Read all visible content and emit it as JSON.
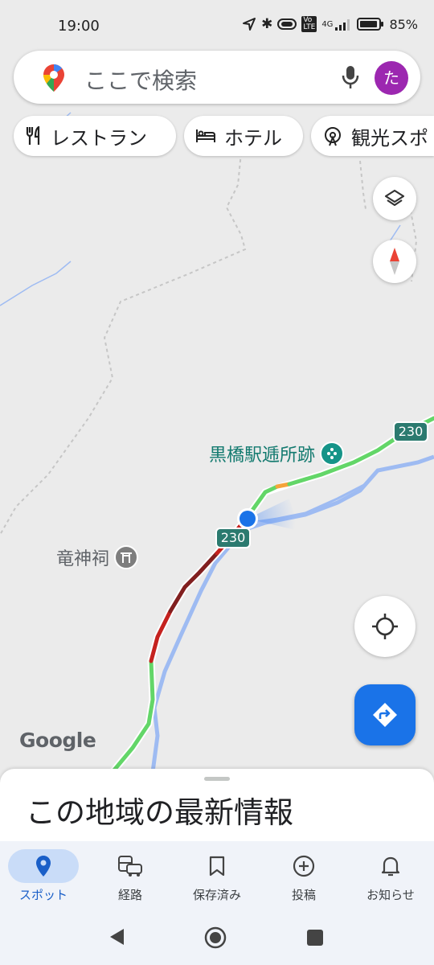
{
  "status_bar": {
    "time": "19:00",
    "network": "4G",
    "battery": "85%"
  },
  "search": {
    "placeholder": "ここで検索",
    "avatar_letter": "た"
  },
  "chips": [
    {
      "label": "レストラン",
      "icon": "restaurant-icon"
    },
    {
      "label": "ホテル",
      "icon": "hotel-icon"
    },
    {
      "label": "観光スポ",
      "icon": "attraction-icon"
    }
  ],
  "map": {
    "places": [
      {
        "label": "黒橋駅逓所跡",
        "icon": "landmark-icon"
      },
      {
        "label": "竜神祠",
        "icon": "shrine-icon"
      }
    ],
    "route_shields": [
      "230",
      "230"
    ],
    "attribution": "Google"
  },
  "sheet": {
    "title": "この地域の最新情報"
  },
  "nav": {
    "items": [
      {
        "label": "スポット",
        "icon": "pin-icon",
        "active": true
      },
      {
        "label": "経路",
        "icon": "car-bus-icon"
      },
      {
        "label": "保存済み",
        "icon": "bookmark-icon"
      },
      {
        "label": "投稿",
        "icon": "add-circle-icon"
      },
      {
        "label": "お知らせ",
        "icon": "bell-icon"
      }
    ]
  },
  "colors": {
    "map_background": "#ebebeb",
    "accent_blue": "#1a73e8",
    "traffic_green": "#63d668",
    "traffic_red": "#c5221f",
    "traffic_dark_red": "#811f1f",
    "water": "#9ebbf2"
  }
}
